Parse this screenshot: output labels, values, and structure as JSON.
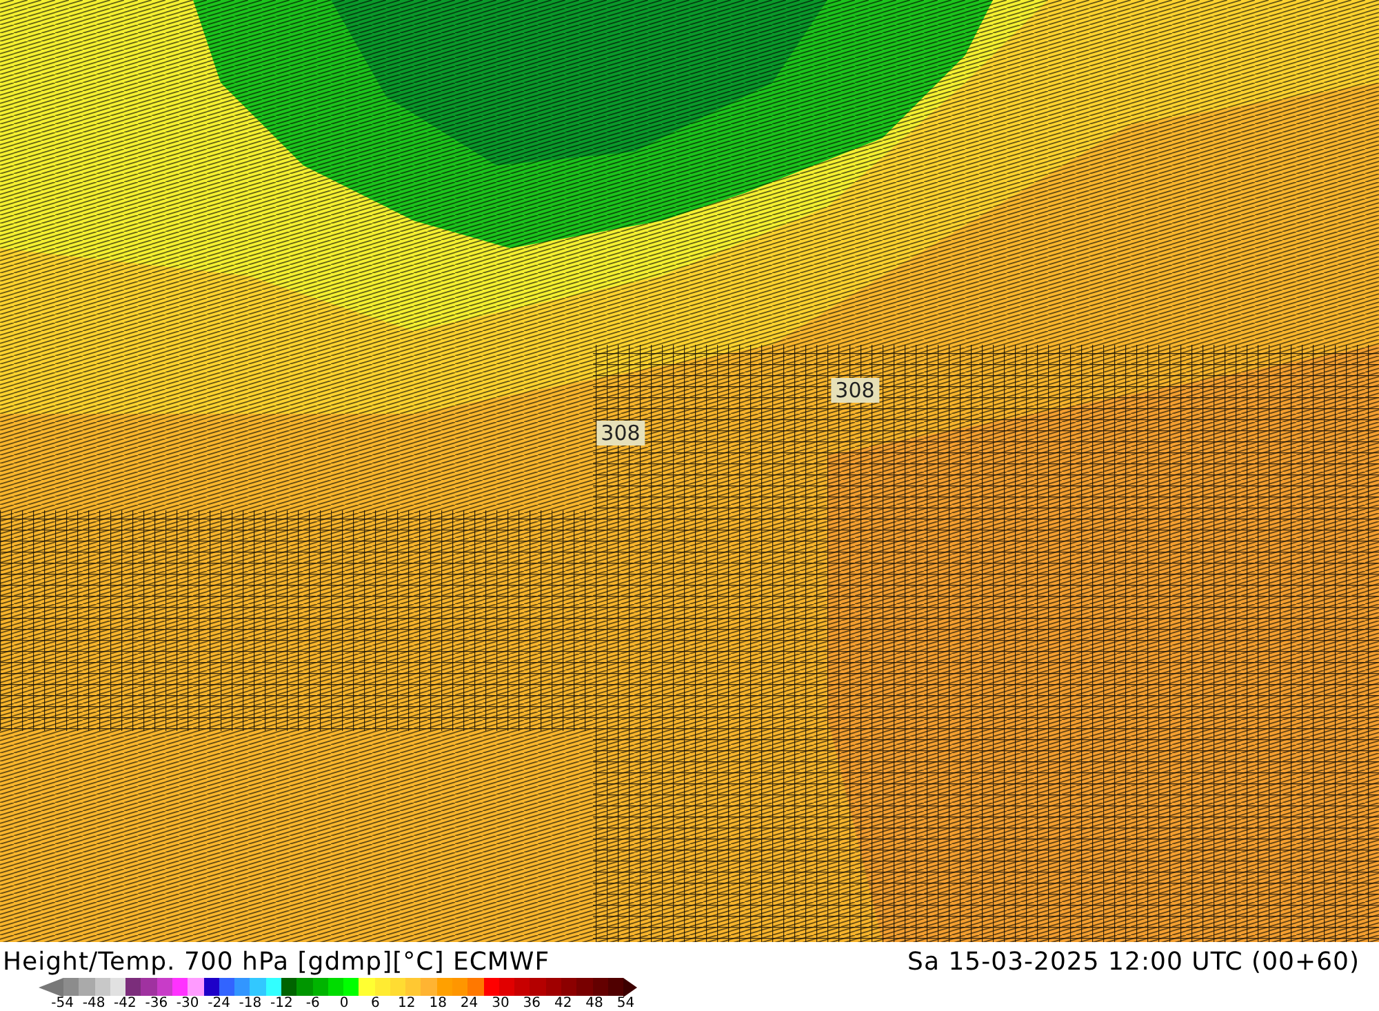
{
  "map": {
    "contour_labels": [
      "308",
      "308"
    ]
  },
  "title": "Height/Temp. 700 hPa [gdmp][°C] ECMWF",
  "timestamp": "Sa 15-03-2025 12:00 UTC (00+60)",
  "legend": {
    "swatches": [
      {
        "color": "#8c8c8c"
      },
      {
        "color": "#aaaaaa"
      },
      {
        "color": "#c8c8c8"
      },
      {
        "color": "#e1e1e1"
      },
      {
        "color": "#7b2d7b"
      },
      {
        "color": "#a032a0"
      },
      {
        "color": "#c83cc8"
      },
      {
        "color": "#ff32ff"
      },
      {
        "color": "#ff9bff"
      },
      {
        "color": "#1e00c8"
      },
      {
        "color": "#3264ff"
      },
      {
        "color": "#3296ff"
      },
      {
        "color": "#32c8ff"
      },
      {
        "color": "#32ffff"
      },
      {
        "color": "#006400"
      },
      {
        "color": "#009600"
      },
      {
        "color": "#00b400"
      },
      {
        "color": "#00dc00"
      },
      {
        "color": "#00ff00"
      },
      {
        "color": "#ffff32"
      },
      {
        "color": "#ffeb32"
      },
      {
        "color": "#ffdc32"
      },
      {
        "color": "#ffc832"
      },
      {
        "color": "#ffb432"
      },
      {
        "color": "#ffa000"
      },
      {
        "color": "#ff9600"
      },
      {
        "color": "#ff7800"
      },
      {
        "color": "#ff0000"
      },
      {
        "color": "#e10000"
      },
      {
        "color": "#c80000"
      },
      {
        "color": "#b40000"
      },
      {
        "color": "#a00000"
      },
      {
        "color": "#8c0000"
      },
      {
        "color": "#780000"
      },
      {
        "color": "#640000"
      },
      {
        "color": "#500000"
      }
    ],
    "ticks": [
      "-54",
      "-48",
      "-42",
      "-36",
      "-30",
      "-24",
      "-18",
      "-12",
      "-6",
      "0",
      "6",
      "12",
      "18",
      "24",
      "30",
      "36",
      "42",
      "48",
      "54"
    ]
  }
}
